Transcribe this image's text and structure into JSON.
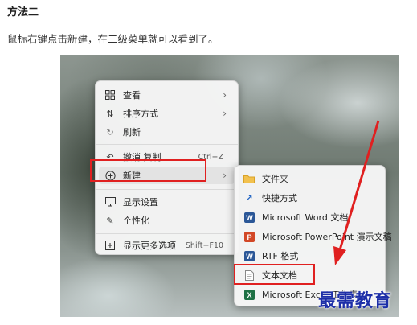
{
  "article": {
    "heading": "方法二",
    "description": "鼠标右键点击新建，在二级菜单就可以看到了。"
  },
  "context_menu": {
    "items": [
      {
        "label": "查看",
        "icon": "grid-icon"
      },
      {
        "label": "排序方式",
        "icon": "sort-icon"
      },
      {
        "label": "刷新",
        "icon": "refresh-icon"
      },
      {
        "label": "撤消 复制",
        "icon": "undo-icon",
        "shortcut": "Ctrl+Z"
      },
      {
        "label": "新建",
        "icon": "new-plus-icon"
      },
      {
        "label": "显示设置",
        "icon": "display-icon"
      },
      {
        "label": "个性化",
        "icon": "brush-icon"
      },
      {
        "label": "显示更多选项",
        "icon": "more-options-icon",
        "shortcut": "Shift+F10"
      }
    ]
  },
  "submenu": {
    "items": [
      {
        "label": "文件夹",
        "icon": "folder-icon"
      },
      {
        "label": "快捷方式",
        "icon": "shortcut-icon"
      },
      {
        "label": "Microsoft Word 文档",
        "icon": "word-icon"
      },
      {
        "label": "Microsoft PowerPoint 演示文稿",
        "icon": "powerpoint-icon"
      },
      {
        "label": "RTF 格式",
        "icon": "rtf-icon"
      },
      {
        "label": "文本文档",
        "icon": "text-document-icon"
      },
      {
        "label": "Microsoft Excel 工作表",
        "icon": "excel-icon"
      }
    ]
  },
  "watermark": "最需教育",
  "colors": {
    "highlight_box": "#e02020",
    "watermark": "#1d2fa8",
    "word": "#2b5797",
    "powerpoint": "#d24726",
    "excel": "#1e7145",
    "folder": "#f2c14e"
  }
}
